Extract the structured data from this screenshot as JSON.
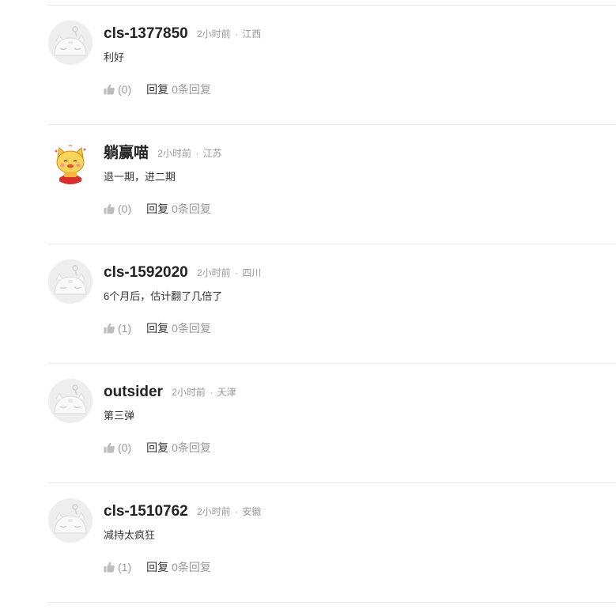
{
  "comments": [
    {
      "username": "cls-1377850",
      "time": "2小时前",
      "separator": "·",
      "location": "江西",
      "content": "利好",
      "likes": "(0)",
      "reply_label": "回复",
      "reply_count": "0条回复",
      "avatar": "default-cat-avatar"
    },
    {
      "username": "躺赢喵",
      "time": "2小时前",
      "separator": "·",
      "location": "江苏",
      "content": "退一期，进二期",
      "likes": "(0)",
      "reply_label": "回复",
      "reply_count": "0条回复",
      "avatar": "cartoon-cat-avatar"
    },
    {
      "username": "cls-1592020",
      "time": "2小时前",
      "separator": "·",
      "location": "四川",
      "content": "6个月后，估计翻了几倍了",
      "likes": "(1)",
      "reply_label": "回复",
      "reply_count": "0条回复",
      "avatar": "default-cat-avatar"
    },
    {
      "username": "outsider",
      "time": "2小时前",
      "separator": "·",
      "location": "天津",
      "content": "第三弹",
      "likes": "(0)",
      "reply_label": "回复",
      "reply_count": "0条回复",
      "avatar": "default-cat-avatar"
    },
    {
      "username": "cls-1510762",
      "time": "2小时前",
      "separator": "·",
      "location": "安徽",
      "content": "减持太疯狂",
      "likes": "(1)",
      "reply_label": "回复",
      "reply_count": "0条回复",
      "avatar": "default-cat-avatar"
    }
  ],
  "colors": {
    "divider": "#e8e8e8",
    "meta": "#999999",
    "text": "#333333",
    "username": "#222222"
  }
}
